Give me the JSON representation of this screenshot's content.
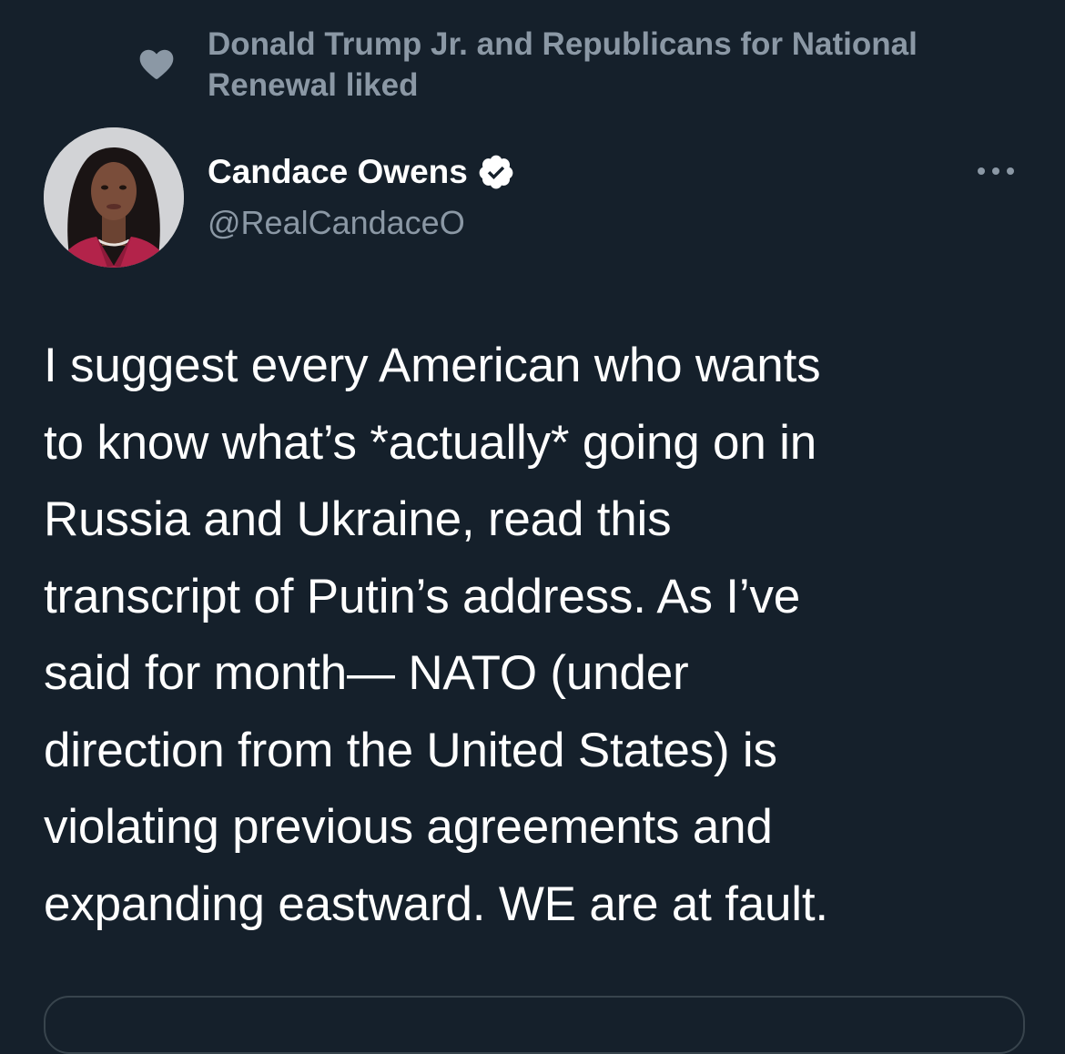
{
  "social_context": {
    "icon": "heart-icon",
    "text": "Donald Trump Jr. and Republicans for National Renewal liked"
  },
  "author": {
    "name": "Candace Owens",
    "handle": "@RealCandaceO",
    "verified_icon": "verified-badge-icon",
    "avatar_alt": "avatar"
  },
  "tweet": {
    "text": "I suggest every American who wants\nto know what’s *actually* going on in\nRussia and Ukraine, read this\ntranscript of Putin’s address. As I’ve\nsaid for month— NATO (under\ndirection from the United States) is\nviolating previous agreements and\nexpanding eastward. WE are at fault."
  },
  "colors": {
    "background": "#15202b",
    "primary_text": "#ffffff",
    "secondary_text": "#8b98a5",
    "border": "#38444d"
  }
}
